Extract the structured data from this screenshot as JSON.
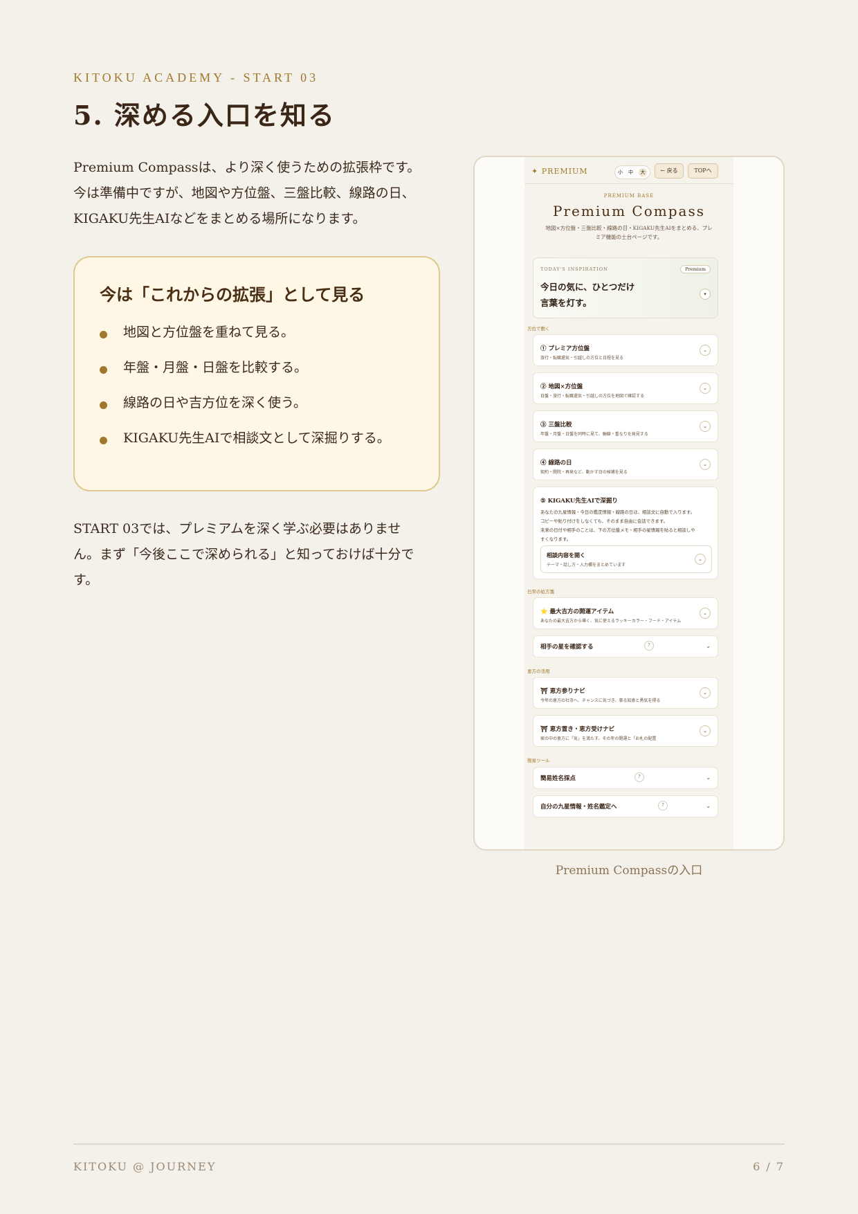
{
  "header": {
    "eyebrow": "KITOKU ACADEMY - START 03",
    "title": "5. 深める入口を知る"
  },
  "intro": [
    "Premium Compassは、より深く使うための拡張枠です。",
    "今は準備中ですが、地図や方位盤、三盤比較、線路の日、",
    "KIGAKU先生AIなどをまとめる場所になります。"
  ],
  "note": {
    "title": "今は「これからの拡張」として見る",
    "items": [
      "地図と方位盤を重ねて見る。",
      "年盤・月盤・日盤を比較する。",
      "線路の日や吉方位を深く使う。",
      "KIGAKU先生AIで相談文として深掘りする。"
    ]
  },
  "outro": [
    "START 03では、プレミアムを深く学ぶ必要はありませ",
    "ん。まず「今後ここで深められる」と知っておけば十分で",
    "す。"
  ],
  "screenshot": {
    "brand": "✦ PREMIUM",
    "sizes": [
      "小",
      "中",
      "大"
    ],
    "back_label": "← 戻る",
    "top_label": "TOPへ",
    "eyebrow": "PREMIUM BASE",
    "title": "Premium Compass",
    "subtitle_lines": [
      "地図×方位盤・三盤比較・線路の日・KIGAKU先生AIをまとめる、プレ",
      "ミア機能の土台ページです。"
    ],
    "inspiration": {
      "label": "TODAY'S INSPIRATION",
      "badge": "Premium",
      "lines": [
        "今日の気に、ひとつだけ",
        "言葉を灯す。"
      ]
    },
    "section_direction": "方位で動く",
    "cards": [
      {
        "title": "① プレミア方位盤",
        "desc": "旅行・転職還気・引越しの方位と日程を見る"
      },
      {
        "title": "② 地図×方位盤",
        "desc": "日盤・旅行・転職還気・引越しの方位を地図で確認する"
      },
      {
        "title": "③ 三盤比較",
        "desc": "年盤・月盤・日盤を同時に見て、軸線・重なりを発見する"
      },
      {
        "title": "④ 線路の日",
        "desc": "契約・開院・再発など、動かす日の候補を見る"
      }
    ],
    "ai_card": {
      "title": "⑤ KIGAKU先生AIで深掘り",
      "body": [
        "あなたの九星情報・今日の鑑定情報・線路の日は、相談文に自動で入ります。",
        "コピーや貼り付けをしなくても、そのまま自由に会話できます。",
        "未来の日付や相手のことは、下の方位盤メモ・相手の星情報を貼ると相談しや",
        "すくなります。"
      ],
      "inner_title": "相談内容を開く",
      "inner_desc": "テーマ・話し方・入力欄をまとめています"
    },
    "section_daily": "日常の処方箋",
    "lucky_card": {
      "title": "⭐ 最大吉方の開運アイテム",
      "desc": "あなたの最大吉方から導く、気に使えるラッキーカラー・フード・アイテム"
    },
    "partner_card": {
      "title": "相手の星を確認する"
    },
    "section_ehou": "恵方の活用",
    "ehou_cards": [
      {
        "title": "⛩ 恵方参りナビ",
        "desc": "今年の恵方の社寺へ、チャンスに気づき、事る知恵と勇気を得る"
      },
      {
        "title": "⛩ 恵方置き・恵方受けナビ",
        "desc": "家の中の恵方に「気」を満たす。その年の開運と「お札の配置"
      }
    ],
    "section_tools": "簡易ツール",
    "tool_cards": [
      {
        "title": "簡易姓名採点"
      },
      {
        "title": "自分の九星情報・姓名鑑定へ"
      }
    ],
    "question_mark": "?",
    "chevron": "⌄"
  },
  "caption": "Premium Compassの入口",
  "footer": {
    "left": "KITOKU @ JOURNEY",
    "right": "6 / 7"
  }
}
